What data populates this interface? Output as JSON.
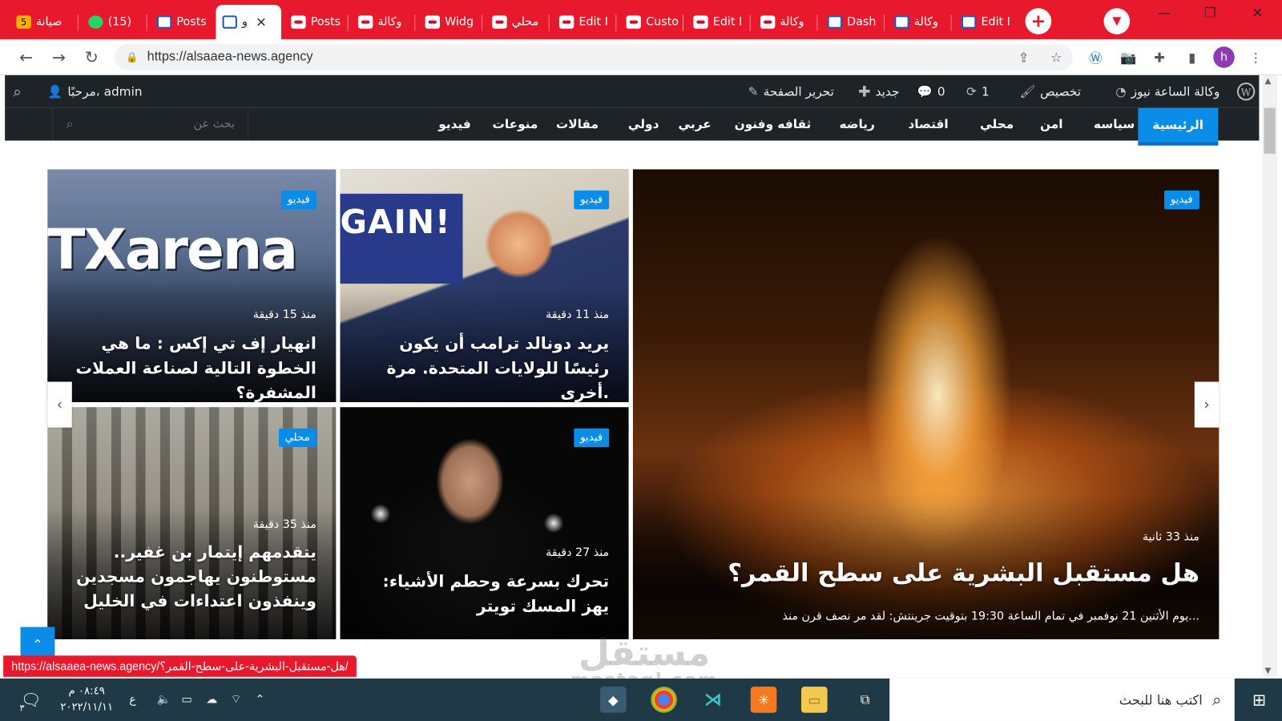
{
  "browser": {
    "tabs": [
      {
        "label": "صيانة",
        "badge": "5",
        "icon": "yellow-5-icon"
      },
      {
        "label": "(15)",
        "icon": "whatsapp-icon"
      },
      {
        "label": "Posts",
        "icon": "site-icon"
      },
      {
        "label": "و",
        "icon": "site-icon",
        "active": true
      },
      {
        "label": "Posts",
        "icon": "red-site-icon"
      },
      {
        "label": "وكالة",
        "icon": "red-site-icon"
      },
      {
        "label": "Widg",
        "icon": "red-site-icon"
      },
      {
        "label": "محلي",
        "icon": "red-site-icon"
      },
      {
        "label": "Edit I",
        "icon": "red-site-icon"
      },
      {
        "label": "Custo",
        "icon": "calendar-icon"
      },
      {
        "label": "Edit I",
        "icon": "calendar-icon"
      },
      {
        "label": "وكالة",
        "icon": "calendar-icon"
      },
      {
        "label": "Dash",
        "icon": "blue-site-icon"
      },
      {
        "label": "وكالة",
        "icon": "blue-site-icon"
      },
      {
        "label": "Edit I",
        "icon": "blue-site-icon"
      }
    ],
    "url": "https://alsaaea-news.agency",
    "status_url": "https://alsaaea-news.agency/هل-مستقبل-البشرية-على-سطح-القمر؟/"
  },
  "wpbar": {
    "site_name": "وكالة الساعة نيوز",
    "customize": "تخصيص",
    "updates": "1",
    "comments": "0",
    "new": "جديد",
    "edit_page": "تحرير الصفحة",
    "greeting": "مرحبًا، admin"
  },
  "nav": {
    "items": [
      "الرئيسية",
      "سياسه",
      "امن",
      "محلي",
      "اقتصاد",
      "رياضه",
      "ثقافه وفنون",
      "عربي",
      "دولي",
      "مقالات",
      "منوعات",
      "فيديو"
    ],
    "search_placeholder": "بحث عن"
  },
  "featured": {
    "badge": "فيديو",
    "time": "منذ 33 ثانية",
    "title": "هل مستقبل البشرية على سطح القمر؟",
    "excerpt": "يوم الأثنين 21 نوفمبر في تمام الساعة 19:30 بتوقيت جرينتش: لقد مر نصف قرن منذ..."
  },
  "cards": [
    {
      "badge": "فيديو",
      "time": "منذ 11 دقيقة",
      "title": "يريد دونالد ترامب أن يكون رئيسًا للولايات المتحدة. مرة أخرى."
    },
    {
      "badge": "فيديو",
      "time": "منذ 15 دقيقة",
      "title": "انهيار إف تي إكس : ما هي الخطوة التالية لصناعة العملات المشفرة؟"
    },
    {
      "badge": "فيديو",
      "time": "منذ 27 دقيقة",
      "title": "تحرك بسرعة وحطم الأشياء: يهز المسك تويتر"
    },
    {
      "badge": "محلي",
      "time": "منذ 35 دقيقة",
      "title": "يتقدمهم إيتمار بن غفير.. مستوطنون يهاجمون مسجدين وينفذون اعتداءات في الخليل"
    }
  ],
  "image_text": {
    "ftx": "TXarena",
    "again": "GAIN!"
  },
  "watermark": {
    "main": "مستقل",
    "sub": "mostaql.com"
  },
  "taskbar": {
    "search_placeholder": "اكتب هنا للبحث",
    "time": "٠٨:٤٩ م",
    "date": "٢٠٢٢/١١/١١",
    "lang": "ع",
    "notif_count": "٣"
  },
  "colors": {
    "tab_strip": "#e8192c",
    "accent": "#0a8de9",
    "wpbar": "#1d2327",
    "taskbar": "#1f3a46"
  }
}
